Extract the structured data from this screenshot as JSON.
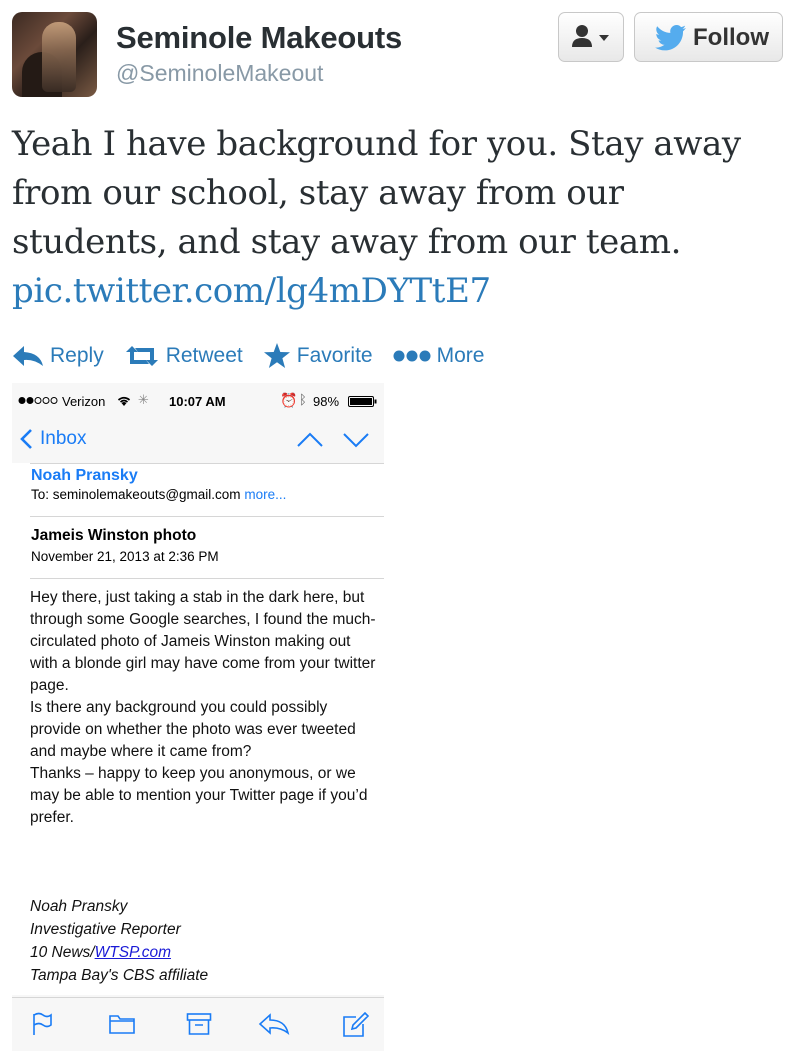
{
  "tweet": {
    "name": "Seminole Makeouts",
    "handle": "@SeminoleMakeout",
    "follow_label": "Follow",
    "text": "Yeah I have background for you. Stay away from our school, stay away from our students, and stay away from our team.",
    "link": "pic.twitter.com/lg4mDYTtE7",
    "actions": {
      "reply": "Reply",
      "retweet": "Retweet",
      "favorite": "Favorite",
      "more": "More"
    },
    "accent_color": "#2b7bb9"
  },
  "phone": {
    "status": {
      "carrier": "Verizon",
      "time": "10:07 AM",
      "battery": "98%"
    },
    "nav": {
      "back_label": "Inbox"
    },
    "email": {
      "from": "Noah Pransky",
      "to_label": "To:",
      "to": "seminolemakeouts@gmail.com",
      "more": "more...",
      "subject": "Jameis Winston photo",
      "date": "November 21, 2013 at 2:36 PM",
      "body": [
        "Hey there, just taking a stab in the dark here, but through some Google searches, I found the much-circulated photo of Jameis Winston making out with a blonde girl may have come from your twitter page.",
        "Is there any background you could possibly provide on whether the photo was ever tweeted and maybe where it came from?",
        "Thanks – happy to keep you anonymous, or we may be able to mention your Twitter page if you’d prefer."
      ],
      "signature": {
        "name": "Noah Pransky",
        "title": "Investigative Reporter",
        "org_prefix": "10 News/",
        "org_link": "WTSP.com",
        "affiliate": "Tampa Bay's CBS affiliate"
      }
    },
    "toolbar_icons": [
      "flag-icon",
      "folder-icon",
      "archive-icon",
      "reply-icon",
      "compose-icon"
    ],
    "accent_color": "#1a7cf5"
  }
}
